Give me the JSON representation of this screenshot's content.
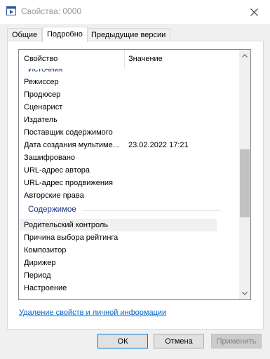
{
  "window": {
    "title": "Свойства: 0000"
  },
  "tabs": [
    {
      "label": "Общие",
      "active": false
    },
    {
      "label": "Подробно",
      "active": true
    },
    {
      "label": "Предыдущие версии",
      "active": false
    }
  ],
  "list": {
    "columns": {
      "property": "Свойство",
      "value": "Значение"
    },
    "group_source": "Источник",
    "rows_source": [
      {
        "name": "Режиссер",
        "value": ""
      },
      {
        "name": "Продюсер",
        "value": ""
      },
      {
        "name": "Сценарист",
        "value": ""
      },
      {
        "name": "Издатель",
        "value": ""
      },
      {
        "name": "Поставщик содержимого",
        "value": ""
      },
      {
        "name": "Дата создания мультиме...",
        "value": "23.02.2022 17:21"
      },
      {
        "name": "Зашифровано",
        "value": ""
      },
      {
        "name": "URL-адрес автора",
        "value": ""
      },
      {
        "name": "URL-адрес продвижения",
        "value": ""
      },
      {
        "name": "Авторские права",
        "value": ""
      }
    ],
    "group_content": "Содержимое",
    "rows_content": [
      {
        "name": "Родительский контроль",
        "value": ""
      },
      {
        "name": "Причина выбора рейтинга",
        "value": ""
      },
      {
        "name": "Композитор",
        "value": ""
      },
      {
        "name": "Дирижер",
        "value": ""
      },
      {
        "name": "Период",
        "value": ""
      },
      {
        "name": "Настроение",
        "value": ""
      }
    ]
  },
  "remove_link": "Удаление свойств и личной информации",
  "buttons": {
    "ok": "ОК",
    "cancel": "Отмена",
    "apply": "Применить"
  },
  "colors": {
    "accent": "#0078d7",
    "group": "#1e3287",
    "link": "#0066cc"
  }
}
